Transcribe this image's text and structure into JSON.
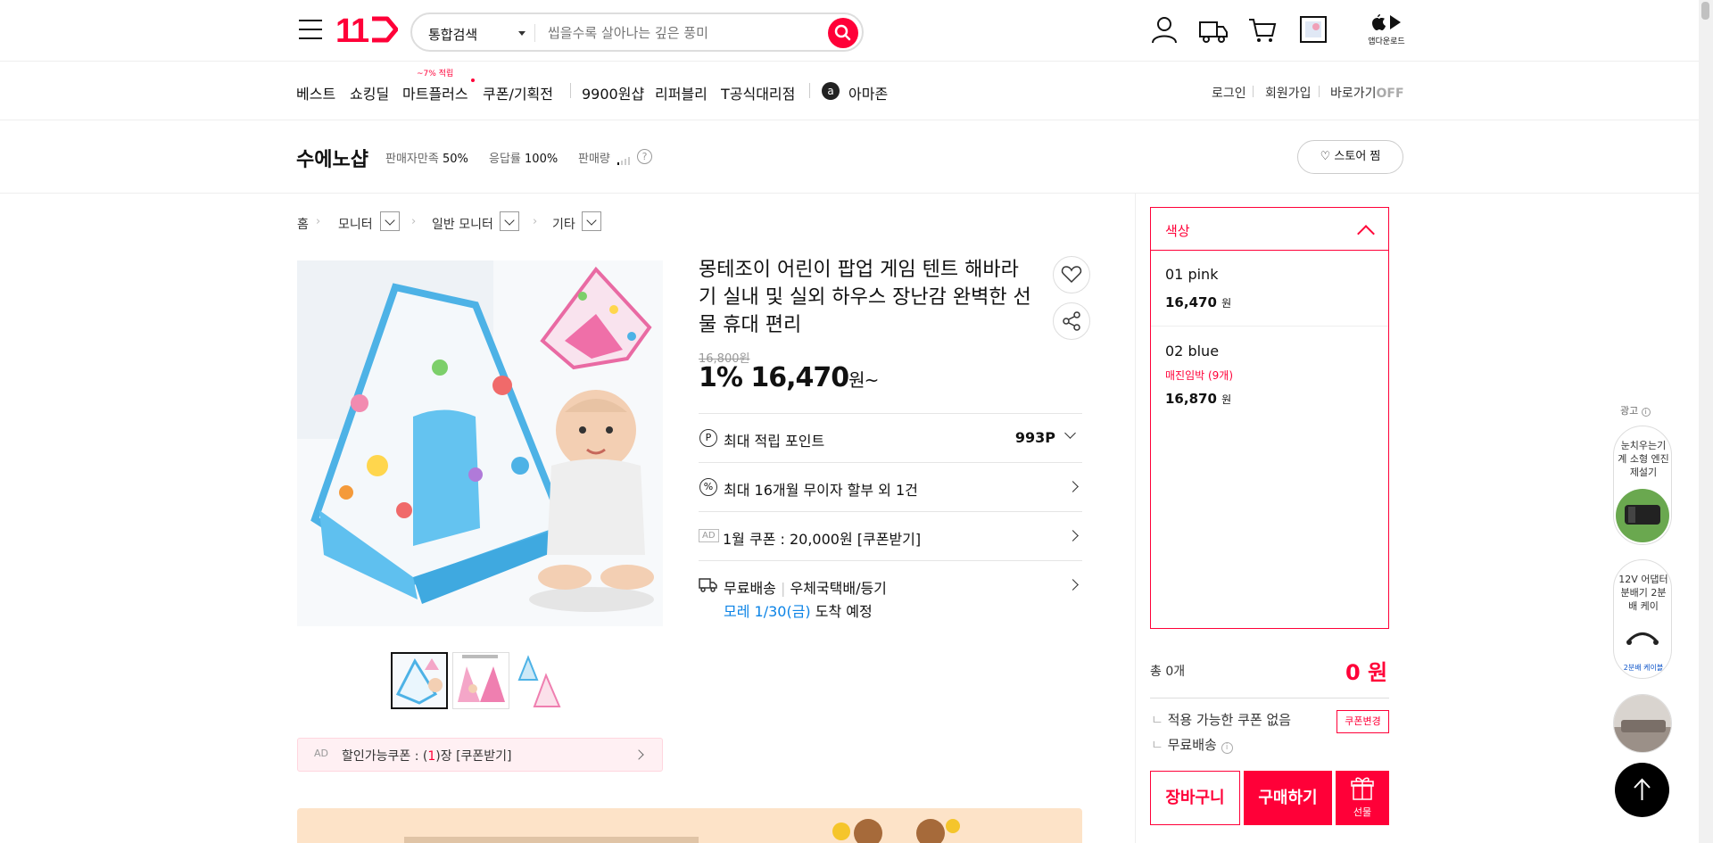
{
  "header": {
    "logo": "11",
    "search_scope": "통합검색",
    "search_placeholder": "씹을수록 살아나는 깊은 풍미",
    "app_download": "앱다운로드"
  },
  "nav": {
    "items": [
      "베스트",
      "쇼킹딜",
      "마트플러스",
      "쿠폰/기획전",
      "9900원샵",
      "리퍼블리",
      "T공식대리점",
      "아마존"
    ],
    "mart_badge": "~7% 적립",
    "right": [
      "로그인",
      "회원가입",
      "바로가기"
    ],
    "shortcut_state": "OFF"
  },
  "store": {
    "name": "수에노샵",
    "satisfaction_label": "판매자만족",
    "satisfaction_value": "50%",
    "response_label": "응답률",
    "response_value": "100%",
    "sales_label": "판매량",
    "follow_button": "스토어 찜"
  },
  "breadcrumb": [
    "홈",
    "모니터",
    "일반 모니터",
    "기타"
  ],
  "product": {
    "title": "몽테조이 어린이 팝업 게임 텐트 해바라기 실내 및 실외 하우스 장난감 완벽한 선물 휴대 편리",
    "original_price": "16,800원",
    "discount": "1%",
    "price": "16,470",
    "price_unit": "원~",
    "points_label": "최대 적립 포인트",
    "points_value": "993P",
    "installment": "최대 16개월 무이자 할부 외 1건",
    "coupon_tag": "AD",
    "coupon": "1월 쿠폰 : 20,000원 [쿠폰받기]",
    "shipping": "무료배송",
    "shipping_method": "우체국택배/등기",
    "delivery_date": "모레 1/30(금)",
    "delivery_suffix": "도착 예정",
    "ad_coupon_tag": "AD",
    "ad_coupon_prefix": "할인가능쿠폰 : (",
    "ad_coupon_count": "1",
    "ad_coupon_suffix": ")장 [쿠폰받기]"
  },
  "options": {
    "header": "색상",
    "items": [
      {
        "name": "01 pink",
        "price": "16,470",
        "unit": "원",
        "stock": ""
      },
      {
        "name": "02 blue",
        "price": "16,870",
        "unit": "원",
        "stock": "매진임박 (9개)"
      }
    ]
  },
  "order": {
    "total_label": "총 0개",
    "total_value": "0 원",
    "no_coupon": "적용 가능한 쿠폰 없음",
    "coupon_change": "쿠폰변경",
    "free_shipping": "무료배송",
    "cart": "장바구니",
    "buy": "구매하기",
    "gift": "선물"
  },
  "rail": {
    "ad_label": "광고",
    "cards": [
      {
        "text": "눈치우는기계 소형 엔진 제설기"
      },
      {
        "text": "12V 어댑터 분배기 2분배 케이"
      }
    ],
    "card_caption": "2분배 케이블"
  },
  "colors": {
    "brand": "#ff0038",
    "link": "#0b83e6"
  }
}
